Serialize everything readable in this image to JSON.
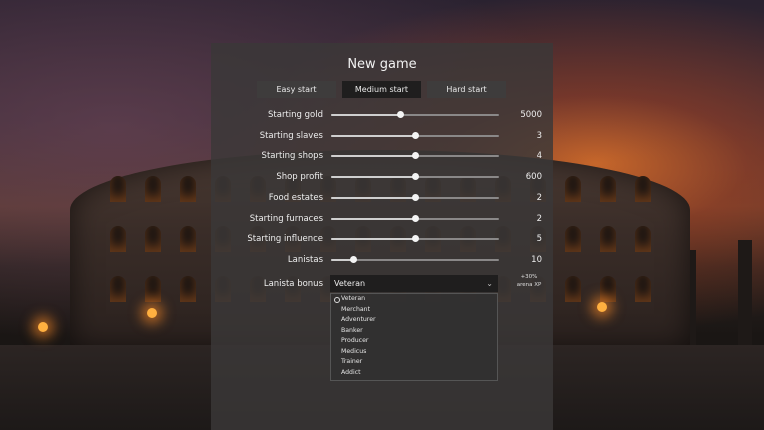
{
  "dialog": {
    "title": "New game",
    "tabs": [
      {
        "label": "Easy start",
        "active": false
      },
      {
        "label": "Medium start",
        "active": true
      },
      {
        "label": "Hard start",
        "active": false
      }
    ]
  },
  "settings": [
    {
      "label": "Starting gold",
      "value": "5000",
      "level": 0.41
    },
    {
      "label": "Starting slaves",
      "value": "3",
      "level": 0.5
    },
    {
      "label": "Starting shops",
      "value": "4",
      "level": 0.5
    },
    {
      "label": "Shop profit",
      "value": "600",
      "level": 0.5
    },
    {
      "label": "Food estates",
      "value": "2",
      "level": 0.5
    },
    {
      "label": "Starting furnaces",
      "value": "2",
      "level": 0.5
    },
    {
      "label": "Starting influence",
      "value": "5",
      "level": 0.5
    },
    {
      "label": "Lanistas",
      "value": "10",
      "level": 0.13
    }
  ],
  "lanista_bonus": {
    "label": "Lanista bonus",
    "selected": "Veteran",
    "description_line1": "+30%",
    "description_line2": "arena XP",
    "options": [
      "Veteran",
      "Merchant",
      "Adventurer",
      "Banker",
      "Producer",
      "Medicus",
      "Trainer",
      "Addict"
    ]
  },
  "icons": {
    "dropdown": "chevron-down-icon",
    "selected_option": "radio-icon"
  },
  "colors": {
    "panel": "#3a3838",
    "active_tab": "#1f1e1e",
    "tab": "#3e3c3c",
    "slider_knob": "#f4f4f4"
  }
}
